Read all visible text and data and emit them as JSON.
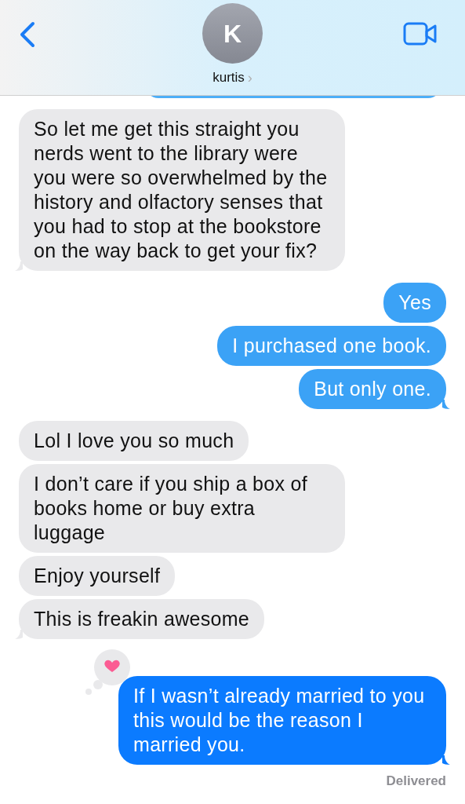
{
  "header": {
    "avatar_initial": "K",
    "contact_name": "kurtis",
    "chevron": "›"
  },
  "messages": [
    {
      "kind": "received",
      "text": "So let me get this straight you nerds went to the library were you were so overwhelmed by the history and olfactory senses that you had to stop at the bookstore on the way back to get your fix?",
      "tail": true
    },
    {
      "kind": "sent",
      "text": "Yes",
      "tail": false,
      "color": "#3ba2f6"
    },
    {
      "kind": "sent",
      "text": "I purchased one book.",
      "tail": false,
      "color": "#3ba2f6"
    },
    {
      "kind": "sent",
      "text": "But only one.",
      "tail": true,
      "color": "#3ba2f6"
    },
    {
      "kind": "received",
      "text": "Lol I love you so much",
      "tail": false
    },
    {
      "kind": "received",
      "text": "I don’t care if you ship a box of books home or buy extra luggage",
      "tail": false
    },
    {
      "kind": "received",
      "text": "Enjoy yourself",
      "tail": false
    },
    {
      "kind": "received",
      "text": "This is freakin awesome",
      "tail": true
    },
    {
      "kind": "sent",
      "text": "If I wasn’t already married to you this would be the reason I married you.",
      "tail": true,
      "color": "#0b7bff",
      "tapback": {
        "kind": "heart"
      }
    }
  ],
  "status": "Delivered"
}
